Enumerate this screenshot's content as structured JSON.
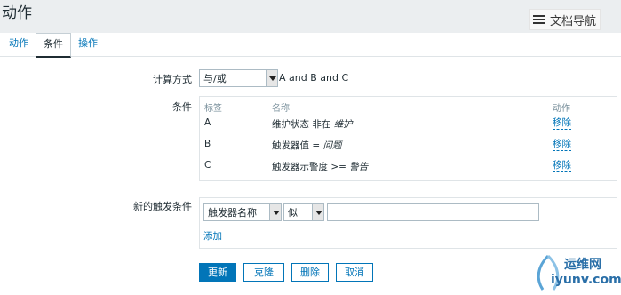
{
  "header": {
    "title": "动作",
    "doc_nav_label": "文档导航"
  },
  "tabs": [
    {
      "label": "动作",
      "active": false
    },
    {
      "label": "条件",
      "active": true
    },
    {
      "label": "操作",
      "active": false
    }
  ],
  "calculation": {
    "label": "计算方式",
    "selected": "与/或",
    "formula": "A and B and C"
  },
  "conditions": {
    "label": "条件",
    "columns": [
      "标签",
      "名称",
      "动作"
    ],
    "rows": [
      {
        "tag": "A",
        "name_prefix": "维护状态 非在 ",
        "name_value": "维护",
        "action": "移除"
      },
      {
        "tag": "B",
        "name_prefix": "触发器值 = ",
        "name_value": "问题",
        "action": "移除"
      },
      {
        "tag": "C",
        "name_prefix": "触发器示警度 >= ",
        "name_value": "警告",
        "action": "移除"
      }
    ]
  },
  "new_condition": {
    "label": "新的触发条件",
    "type_selected": "触发器名称",
    "operator_selected": "似",
    "value": "",
    "add_label": "添加"
  },
  "buttons": {
    "update": "更新",
    "clone": "克隆",
    "delete": "删除",
    "cancel": "取消"
  },
  "watermark": {
    "text_cn": "运维网",
    "text_en": "iyunv.com"
  },
  "colors": {
    "accent": "#0275b8",
    "header_bg": "#ebeef0",
    "text": "#1f2c33",
    "muted": "#768d99"
  }
}
